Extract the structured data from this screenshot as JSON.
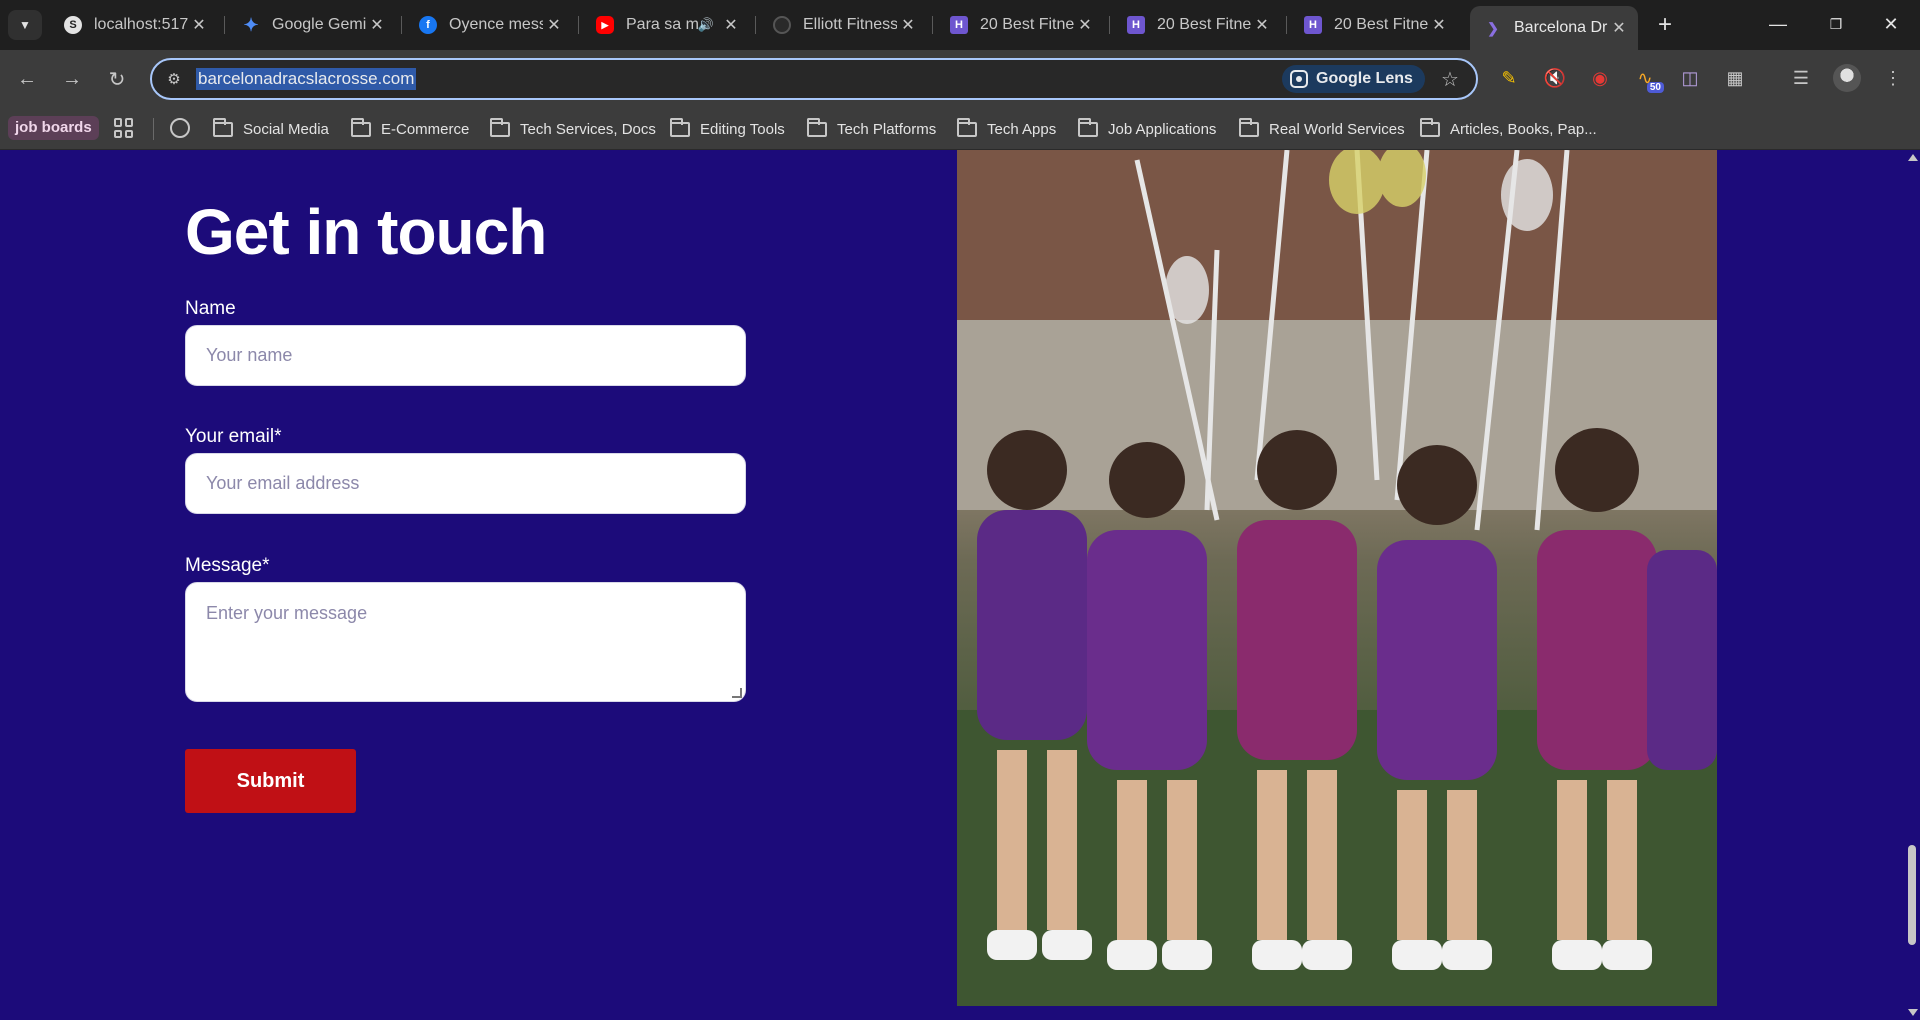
{
  "browser": {
    "tabs": [
      {
        "title": "localhost:517",
        "icon": "app-icon",
        "icon_color": "#e3e3e3"
      },
      {
        "title": "Google Gemi",
        "icon": "gemini-icon",
        "icon_color": "#4f8df7"
      },
      {
        "title": "Oyence mess",
        "icon": "facebook-icon",
        "icon_color": "#1877f2"
      },
      {
        "title": "Para sa m",
        "icon": "youtube-icon",
        "icon_color": "#ff0000"
      },
      {
        "title": "Elliott Fitness",
        "icon": "globe-icon",
        "icon_color": "#2a2a2a"
      },
      {
        "title": "20 Best Fitne",
        "icon": "h-logo-icon",
        "icon_color": "#6e56cf"
      },
      {
        "title": "20 Best Fitne",
        "icon": "h-logo-icon",
        "icon_color": "#6e56cf"
      },
      {
        "title": "20 Best Fitne",
        "icon": "h-logo-icon",
        "icon_color": "#6e56cf"
      },
      {
        "title": "Barcelona Dr",
        "icon": "dragon-icon",
        "icon_color": "#8a6fe0"
      }
    ],
    "url": "barcelonadracslacrosse.com",
    "google_lens_label": "Google Lens",
    "extension_badge": "50",
    "bookmarks": {
      "group_label": "job boards",
      "folders": [
        "Social Media",
        "E-Commerce",
        "Tech Services, Docs",
        "Editing Tools",
        "Tech Platforms",
        "Tech Apps",
        "Job Applications",
        "Real World Services",
        "Articles, Books, Pap..."
      ]
    }
  },
  "contact": {
    "heading": "Get in touch",
    "name_label": "Name",
    "name_placeholder": "Your name",
    "email_label": "Your email*",
    "email_placeholder": "Your email address",
    "message_label": "Message*",
    "message_placeholder": "Enter your message",
    "submit_label": "Submit"
  },
  "colors": {
    "page_background": "#1c0b7a",
    "submit_button": "#c01015",
    "chrome_dark": "#1f1f1f",
    "chrome_toolbar": "#3c3c3c"
  }
}
